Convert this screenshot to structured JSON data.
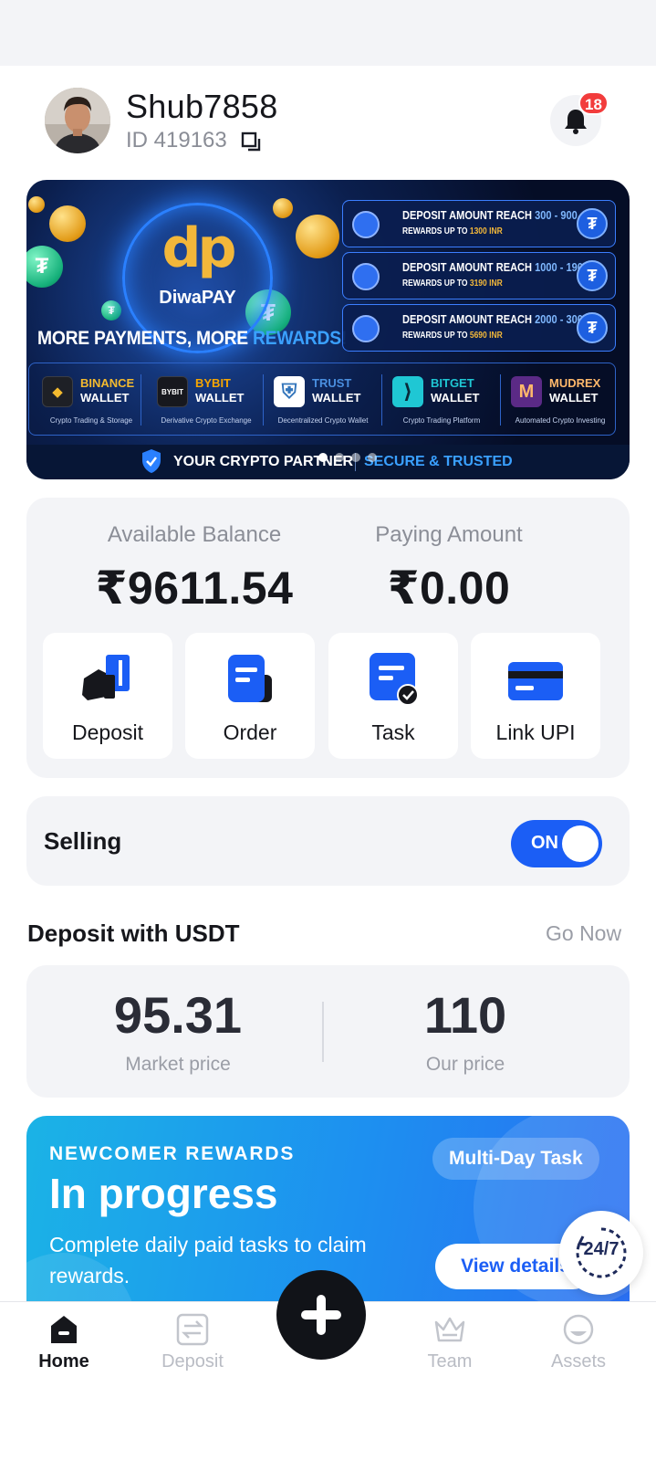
{
  "user": {
    "name": "Shub7858",
    "id_label": "ID 419163",
    "notification_count": "18"
  },
  "banner": {
    "brand": "DiwaPAY",
    "logo_text": "dp",
    "tagline_main": "MORE PAYMENTS, MORE ",
    "tagline_accent": "REWARDS!",
    "promos": [
      {
        "title": "DEPOSIT AMOUNT REACH ",
        "range": "300 - 900",
        "reward_label": "REWARDS UP TO ",
        "reward": "1300 INR"
      },
      {
        "title": "DEPOSIT AMOUNT REACH ",
        "range": "1000 - 1900",
        "reward_label": "REWARDS UP TO ",
        "reward": "3190 INR"
      },
      {
        "title": "DEPOSIT AMOUNT REACH ",
        "range": "2000 - 3000",
        "reward_label": "REWARDS UP TO ",
        "reward": "5690 INR"
      }
    ],
    "wallets": [
      {
        "name": "BINANCE",
        "suffix": "WALLET",
        "sub": "Crypto Trading & Storage",
        "color": "#f3ba2f",
        "logo": "◆",
        "logo_bg": "#1e2026"
      },
      {
        "name": "BYBIT",
        "suffix": "WALLET",
        "sub": "Derivative Crypto Exchange",
        "color": "#f7a600",
        "logo": "BYBIT",
        "logo_bg": "#17181e"
      },
      {
        "name": "TRUST",
        "suffix": "WALLET",
        "sub": "Decentralized Crypto Wallet",
        "color": "#3375bb",
        "logo": "⛨",
        "logo_bg": "#ffffff"
      },
      {
        "name": "BITGET",
        "suffix": "WALLET",
        "sub": "Crypto Trading Platform",
        "color": "#1da2b4",
        "logo": "⟩",
        "logo_bg": "#1fc7d4"
      },
      {
        "name": "MUDREX",
        "suffix": "WALLET",
        "sub": "Automated Crypto Investing",
        "color": "#ffb86b",
        "logo": "M",
        "logo_bg": "#5b2a86"
      }
    ],
    "partner_text": "YOUR CRYPTO PARTNER",
    "secure_text": "SECURE & TRUSTED"
  },
  "balance": {
    "available_label": "Available Balance",
    "available_value": "₹9611.54",
    "paying_label": "Paying Amount",
    "paying_value": "₹0.00"
  },
  "actions": [
    {
      "label": "Deposit",
      "icon": "deposit-icon"
    },
    {
      "label": "Order",
      "icon": "order-icon"
    },
    {
      "label": "Task",
      "icon": "task-icon"
    },
    {
      "label": "Link UPI",
      "icon": "card-icon"
    }
  ],
  "selling": {
    "label": "Selling",
    "toggle_label": "ON",
    "enabled": true
  },
  "usdt": {
    "title": "Deposit with USDT",
    "go_now": "Go Now",
    "market_price": "95.31",
    "market_label": "Market price",
    "our_price": "110",
    "our_label": "Our price"
  },
  "rewards": {
    "kicker": "NEWCOMER REWARDS",
    "title": "In progress",
    "description": "Complete daily paid tasks to claim rewards.",
    "pill": "Multi-Day Task",
    "button": "View details"
  },
  "support": {
    "label": "24/7"
  },
  "nav": [
    {
      "label": "Home",
      "icon": "home-icon",
      "active": true
    },
    {
      "label": "Deposit",
      "icon": "exchange-icon",
      "active": false
    },
    {
      "label": "Team",
      "icon": "crown-icon",
      "active": false
    },
    {
      "label": "Assets",
      "icon": "assets-icon",
      "active": false
    }
  ],
  "colors": {
    "accent": "#1b5ef5",
    "badge": "#f23c3c",
    "page_bg": "#f3f4f7"
  }
}
